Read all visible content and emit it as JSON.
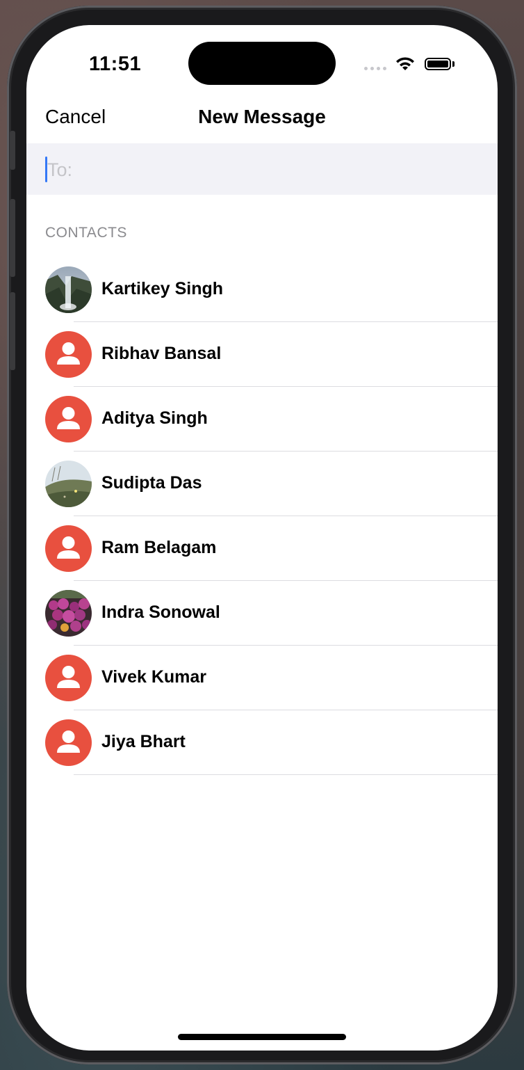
{
  "status_bar": {
    "time": "11:51"
  },
  "nav": {
    "cancel_label": "Cancel",
    "title": "New Message"
  },
  "to_field": {
    "label": "To:"
  },
  "contacts": {
    "header": "CONTACTS",
    "items": [
      {
        "name": "Kartikey Singh",
        "avatar": "waterfall-photo"
      },
      {
        "name": "Ribhav Bansal",
        "avatar": "placeholder"
      },
      {
        "name": "Aditya Singh",
        "avatar": "placeholder"
      },
      {
        "name": "Sudipta Das",
        "avatar": "hillside-photo"
      },
      {
        "name": "Ram Belagam",
        "avatar": "placeholder"
      },
      {
        "name": "Indra Sonowal",
        "avatar": "flowers-photo"
      },
      {
        "name": "Vivek Kumar",
        "avatar": "placeholder"
      },
      {
        "name": "Jiya Bhart",
        "avatar": "placeholder"
      }
    ]
  },
  "colors": {
    "accent": "#3478f6",
    "placeholder_avatar": "#e8503f"
  }
}
